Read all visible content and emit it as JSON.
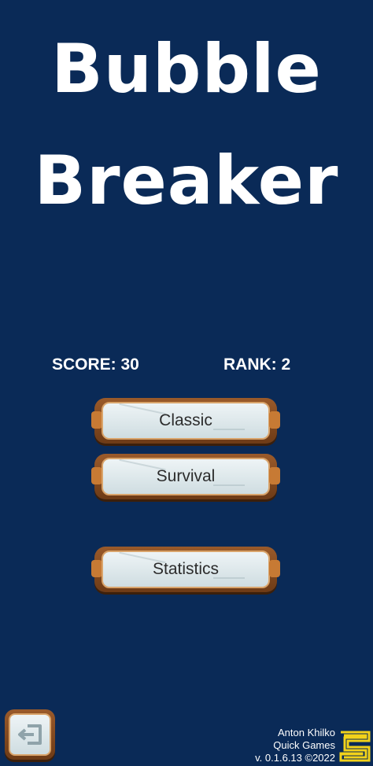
{
  "game": {
    "title_line1": "Bubble",
    "title_line2": "Breaker"
  },
  "stats": {
    "score": "SCORE: 30",
    "rank": "RANK: 2"
  },
  "menu": {
    "classic_label": "Classic",
    "survival_label": "Survival",
    "statistics_label": "Statistics"
  },
  "footer": {
    "author": "Anton Khilko",
    "studio": "Quick Games",
    "version": "v. 0.1.6.13 ©2022",
    "exit_icon": "exit-icon",
    "logo_icon": "quick-games-logo"
  },
  "colors": {
    "background": "#0a2a57",
    "button_frame": "#8b4d22",
    "button_face": "#e3ecef",
    "logo": "#f2d21a"
  }
}
